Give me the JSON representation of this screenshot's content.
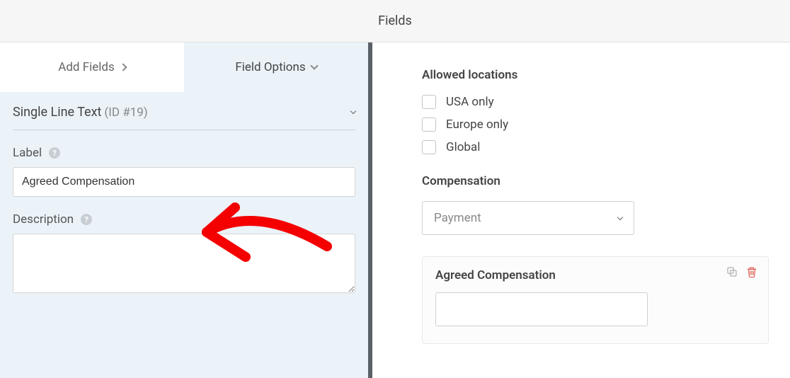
{
  "header": {
    "title": "Fields"
  },
  "tabs": {
    "add_fields": "Add Fields",
    "field_options": "Field Options"
  },
  "field_type": {
    "name": "Single Line Text",
    "id": "(ID #19)"
  },
  "form": {
    "label_text": "Label",
    "label_value": "Agreed Compensation",
    "description_text": "Description",
    "description_value": ""
  },
  "allowed_locations": {
    "title": "Allowed locations",
    "options": [
      "USA only",
      "Europe only",
      "Global"
    ]
  },
  "compensation": {
    "title": "Compensation",
    "selected": "Payment"
  },
  "preview": {
    "label": "Agreed Compensation"
  }
}
